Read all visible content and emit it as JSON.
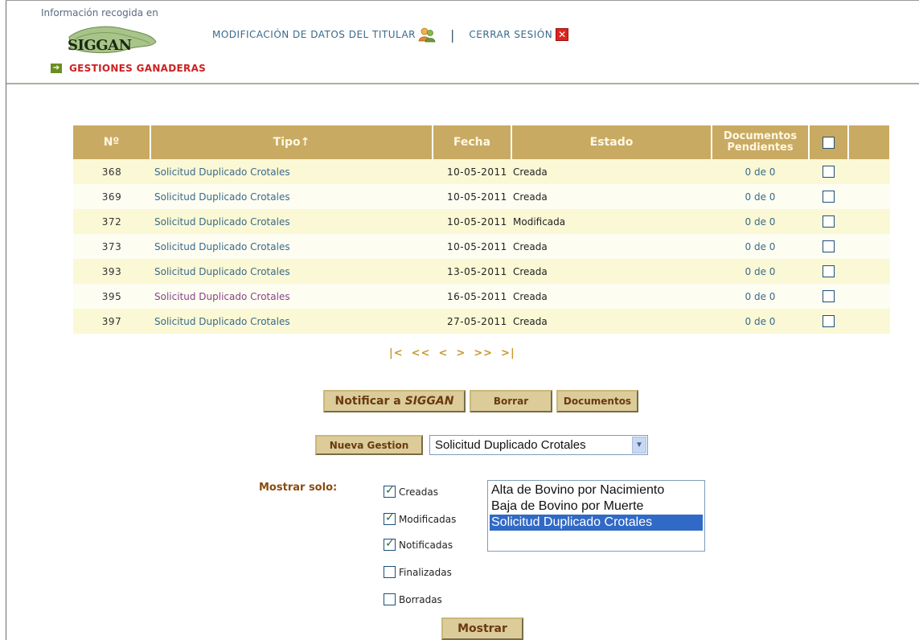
{
  "header": {
    "info_text": "Información recogida en",
    "logo_text": "SIGGAN",
    "modificacion_label": "MODIFICACIÓN DE DATOS DEL TITULAR",
    "separator": "|",
    "cerrar_label": "CERRAR SESIÓN",
    "close_glyph": "✕",
    "gestiones_label": "GESTIONES GANADERAS"
  },
  "table": {
    "headers": {
      "num": "Nº",
      "tipo": "Tipo↑",
      "fecha": "Fecha",
      "estado": "Estado",
      "docs_line1": "Documentos",
      "docs_line2": "Pendientes"
    },
    "rows": [
      {
        "num": "368",
        "tipo": "Solicitud Duplicado Crotales",
        "fecha": "10-05-2011",
        "estado": "Creada",
        "docs": "0 de 0"
      },
      {
        "num": "369",
        "tipo": "Solicitud Duplicado Crotales",
        "fecha": "10-05-2011",
        "estado": "Creada",
        "docs": "0 de 0"
      },
      {
        "num": "372",
        "tipo": "Solicitud Duplicado Crotales",
        "fecha": "10-05-2011",
        "estado": "Modificada",
        "docs": "0 de 0"
      },
      {
        "num": "373",
        "tipo": "Solicitud Duplicado Crotales",
        "fecha": "10-05-2011",
        "estado": "Creada",
        "docs": "0 de 0"
      },
      {
        "num": "393",
        "tipo": "Solicitud Duplicado Crotales",
        "fecha": "13-05-2011",
        "estado": "Creada",
        "docs": "0 de 0"
      },
      {
        "num": "395",
        "tipo": "Solicitud Duplicado Crotales",
        "fecha": "16-05-2011",
        "estado": "Creada",
        "docs": "0 de 0"
      },
      {
        "num": "397",
        "tipo": "Solicitud Duplicado Crotales",
        "fecha": "27-05-2011",
        "estado": "Creada",
        "docs": "0 de 0"
      }
    ]
  },
  "pager": {
    "first": "|<",
    "prev_page": "<<",
    "prev": "<",
    "next": ">",
    "next_page": ">>",
    "last": ">|"
  },
  "buttons": {
    "notificar_prefix": "Notificar a ",
    "notificar_target": "SIGGAN",
    "borrar": "Borrar",
    "documentos": "Documentos",
    "nueva_gestion": "Nueva Gestion",
    "mostrar": "Mostrar"
  },
  "gestion_select": {
    "selected": "Solicitud Duplicado Crotales"
  },
  "filters": {
    "label": "Mostrar solo:",
    "items": [
      {
        "label": "Creadas",
        "checked": true
      },
      {
        "label": "Modificadas",
        "checked": true
      },
      {
        "label": "Notificadas",
        "checked": true
      },
      {
        "label": "Finalizadas",
        "checked": false
      },
      {
        "label": "Borradas",
        "checked": false
      }
    ]
  },
  "listbox": {
    "options": [
      {
        "label": "Alta de Bovino por Nacimiento",
        "selected": false
      },
      {
        "label": "Baja de Bovino por Muerte",
        "selected": false
      },
      {
        "label": "Solicitud Duplicado Crotales",
        "selected": true
      }
    ]
  },
  "colors": {
    "header_bg": "#c9aa62",
    "row_odd": "#fbf8d6",
    "row_even": "#fdfdf2",
    "link": "#3a6a8a",
    "accent_red": "#cc2222",
    "button_bg": "#dbcc9a"
  }
}
